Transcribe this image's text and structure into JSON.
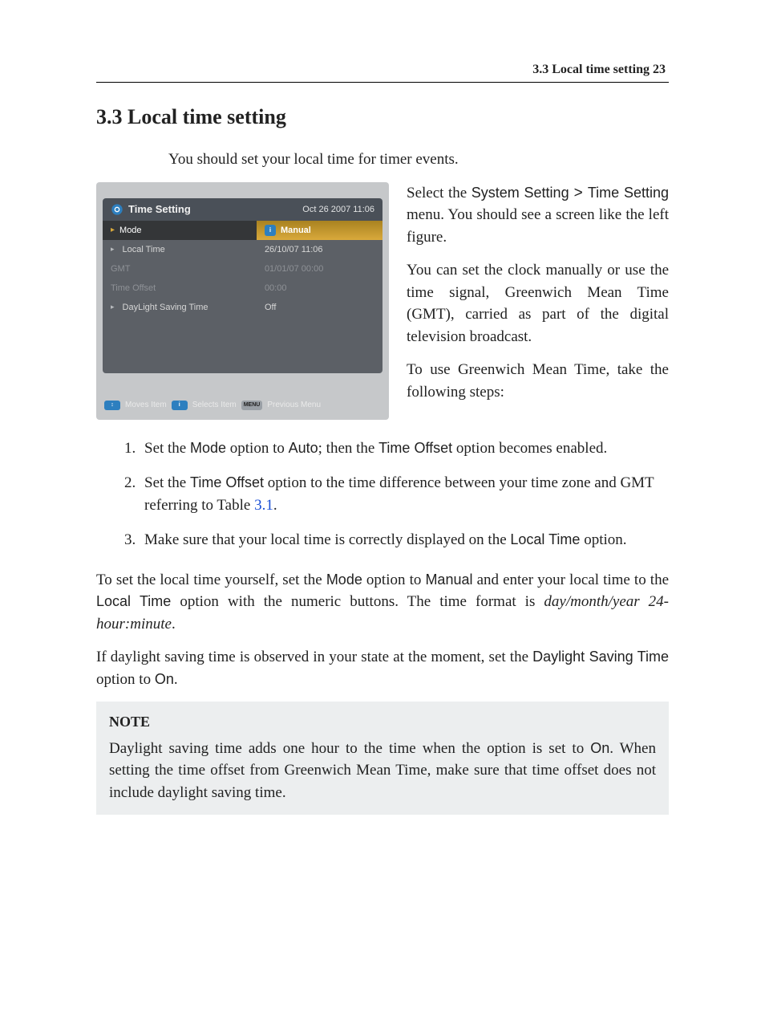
{
  "header": {
    "text": "3.3 Local time setting    23"
  },
  "section": {
    "number": "3.3",
    "title": "Local time setting",
    "heading": "3.3   Local time setting"
  },
  "intro": "You should set your local time for timer events.",
  "figure": {
    "panel_title": "Time Setting",
    "timestamp": "Oct 26 2007 11:06",
    "selected": {
      "label": "Mode",
      "value": "Manual"
    },
    "rows": [
      {
        "label": "Local Time",
        "value": "26/10/07 11:06",
        "disabled": false
      },
      {
        "label": "GMT",
        "value": "01/01/07 00:00",
        "disabled": true
      },
      {
        "label": "Time Offset",
        "value": "00:00",
        "disabled": true
      },
      {
        "label": "DayLight Saving Time",
        "value": "Off",
        "disabled": false
      }
    ],
    "hints": {
      "moves": "Moves Item",
      "selects": "Selects Item",
      "prev": "Previous Menu",
      "menu_badge": "MENU"
    }
  },
  "side_paras": {
    "p1_a": "Select the ",
    "p1_b": "System Setting",
    "p1_c": " > ",
    "p1_d": "Time Setting",
    "p1_e": " menu. You should see a screen like the left figure.",
    "p2": "You can set the clock manually or use the time signal, Greenwich Mean Time (GMT), carried as part of the digital television broadcast.",
    "p3": "To use Greenwich Mean Time, take the following steps:"
  },
  "steps": {
    "s1_a": "Set the ",
    "s1_b": "Mode",
    "s1_c": " option to ",
    "s1_d": "Auto",
    "s1_e": "; then the ",
    "s1_f": "Time Offset",
    "s1_g": " option becomes enabled.",
    "s2_a": "Set the ",
    "s2_b": "Time Offset",
    "s2_c": " option to the time difference between your time zone and GMT referring to Table ",
    "s2_d": "3.1",
    "s2_e": ".",
    "s3_a": "Make sure that your local time is correctly displayed on the ",
    "s3_b": "Local Time",
    "s3_c": " option."
  },
  "after": {
    "p1_a": "To set the local time yourself, set the ",
    "p1_b": "Mode",
    "p1_c": " option to ",
    "p1_d": "Manual",
    "p1_e": " and enter your local time to the ",
    "p1_f": "Local Time",
    "p1_g": " option with the numeric buttons. The time format is ",
    "p1_h": "day/month/year 24-hour:minute",
    "p1_i": ".",
    "p2_a": "If daylight saving time is observed in your state at the moment, set the ",
    "p2_b": "Daylight Saving Time",
    "p2_c": " option to ",
    "p2_d": "On",
    "p2_e": "."
  },
  "note": {
    "title": "NOTE",
    "t1": "Daylight saving time adds one hour to the time when the option is set to ",
    "t2": "On",
    "t3": ". When setting the time offset from Greenwich Mean Time, make sure that time offset does not include daylight saving time."
  }
}
